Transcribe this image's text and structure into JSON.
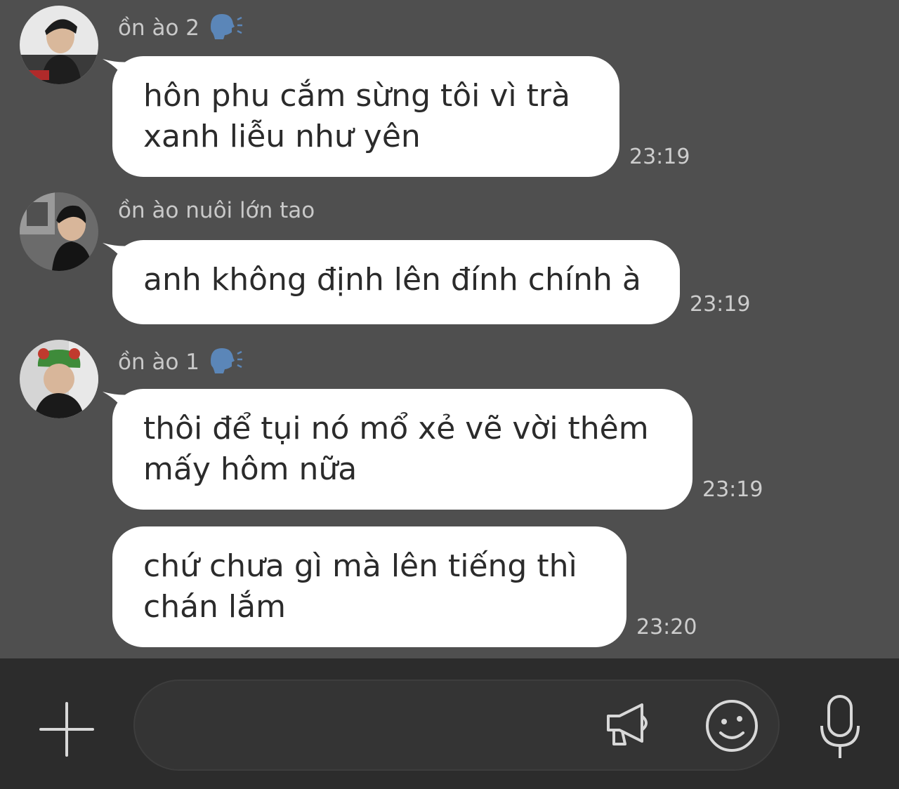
{
  "messages": [
    {
      "sender": "ồn ào 2",
      "has_speaker_icon": true,
      "avatar_icon": "user-photo",
      "bubbles": [
        {
          "text": "hôn phu cắm sừng tôi vì trà xanh liễu như yên",
          "time": "23:19"
        }
      ]
    },
    {
      "sender": "ồn ào nuôi lớn tao",
      "has_speaker_icon": false,
      "avatar_icon": "user-photo",
      "bubbles": [
        {
          "text": "anh không định lên đính chính à",
          "time": "23:19"
        }
      ]
    },
    {
      "sender": "ồn ào 1",
      "has_speaker_icon": true,
      "avatar_icon": "user-photo",
      "bubbles": [
        {
          "text": "thôi để tụi nó mổ xẻ vẽ vời thêm mấy hôm nữa",
          "time": "23:19"
        },
        {
          "text": "chứ chưa gì mà lên tiếng thì chán lắm",
          "time": "23:20"
        }
      ]
    }
  ],
  "composer": {
    "input_value": "",
    "icons": [
      "plus-icon",
      "megaphone-icon",
      "emoji-icon",
      "microphone-icon"
    ]
  },
  "colors": {
    "background": "#4f4f4f",
    "bubble": "#ffffff",
    "composer_bar": "#2c2c2c",
    "speaker_icon": "#5b86b8"
  }
}
